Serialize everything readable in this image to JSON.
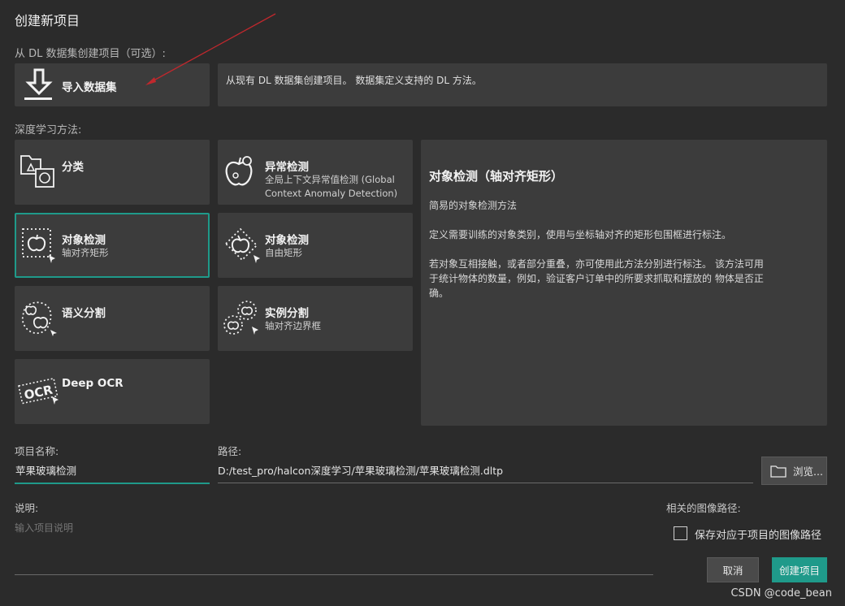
{
  "dialog_title": "创建新项目",
  "import_section": {
    "label": "从 DL 数据集创建项目（可选）:",
    "button_label": "导入数据集",
    "info_text": "从现有 DL 数据集创建项目。 数据集定义支持的 DL 方法。"
  },
  "methods": {
    "section_label": "深度学习方法:",
    "items": [
      {
        "label": "分类",
        "sub": ""
      },
      {
        "label": "异常检测",
        "sub": "全局上下文异常值检测 (Global",
        "sub2": "Context Anomaly Detection)"
      },
      {
        "label": "对象检测",
        "sub": "轴对齐矩形"
      },
      {
        "label": "对象检测",
        "sub": "自由矩形"
      },
      {
        "label": "语义分割",
        "sub": ""
      },
      {
        "label": "实例分割",
        "sub": "轴对齐边界框"
      },
      {
        "label": "Deep OCR",
        "sub": ""
      }
    ],
    "selected_index": 2
  },
  "description": {
    "title": "对象检测（轴对齐矩形）",
    "line1": "简易的对象检测方法",
    "line2": "定义需要训练的对象类别，使用与坐标轴对齐的矩形包围框进行标注。",
    "line3a": "若对象互相接触，或者部分重叠，亦可使用此方法分别进行标注。 该方法可用",
    "line3b": "于统计物体的数量，例如，验证客户订单中的所要求抓取和摆放的 物体是否正",
    "line3c": "确。"
  },
  "project_name": {
    "label": "项目名称:",
    "value": "苹果玻璃检测"
  },
  "path": {
    "label": "路径:",
    "value": "D:/test_pro/halcon深度学习/苹果玻璃检测/苹果玻璃检测.dltp",
    "browse_label": "浏览..."
  },
  "notes": {
    "label": "说明:",
    "placeholder": "输入项目说明"
  },
  "image_path": {
    "label": "相关的图像路径:",
    "checkbox_label": "保存对应于项目的图像路径",
    "checked": false
  },
  "buttons": {
    "cancel": "取消",
    "create": "创建项目"
  },
  "watermark": "CSDN @code_bean",
  "colors": {
    "background": "#2b2b2b",
    "card": "#3c3c3c",
    "accent": "#1f9a8a",
    "annotation_arrow": "#c0282d"
  },
  "icons": {
    "import": "download-icon",
    "classification": "folder-images-icon",
    "anomaly": "apple-anomaly-icon",
    "detection_axis": "dotted-box-apple-icon",
    "detection_free": "rotated-box-apple-icon",
    "segmentation": "dotted-blob-apple-icon",
    "instance": "dotted-circles-apple-icon",
    "ocr": "ocr-stamp-icon",
    "browse": "folder-icon"
  }
}
